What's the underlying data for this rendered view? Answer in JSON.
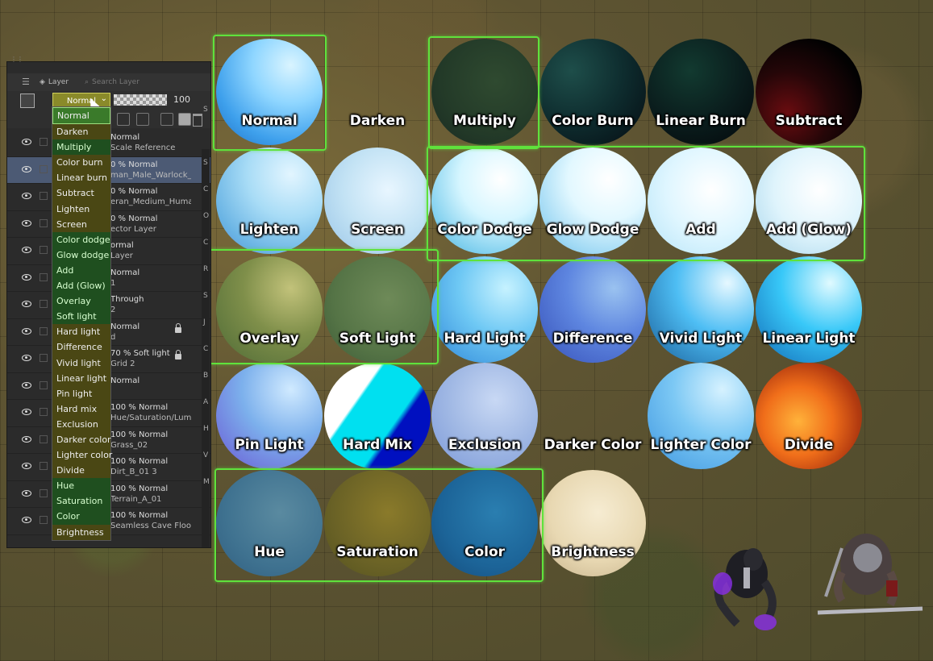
{
  "panel": {
    "tab_layer": "Layer",
    "tab_search": "Search Layer",
    "blend_value": "Normal",
    "opacity": "100",
    "layers": [
      {
        "line1": "Normal",
        "line2": "Scale Reference",
        "sel": false
      },
      {
        "line1": "0 % Normal",
        "line2": "man_Male_Warlock_Mag",
        "sel": true
      },
      {
        "line1": "0 % Normal",
        "line2": "eran_Medium_Humanoid",
        "sel": false
      },
      {
        "line1": "0 % Normal",
        "line2": "ector Layer",
        "sel": false
      },
      {
        "line1": "ormal",
        "line2": "Layer",
        "sel": false
      },
      {
        "line1": "Normal",
        "line2": "1",
        "sel": false
      },
      {
        "line1": "Through",
        "line2": "2",
        "sel": false
      },
      {
        "line1": "Normal",
        "line2": "d",
        "sel": false
      },
      {
        "line1": "70 % Soft light",
        "line2": "Grid 2",
        "sel": false
      },
      {
        "line1": "Normal",
        "line2": "",
        "sel": false
      },
      {
        "line1": "100 % Normal",
        "line2": "Hue/Saturation/Lum",
        "sel": false
      },
      {
        "line1": "100 % Normal",
        "line2": "Grass_02",
        "sel": false
      },
      {
        "line1": "100 % Normal",
        "line2": "Dirt_B_01 3",
        "sel": false
      },
      {
        "line1": "100 % Normal",
        "line2": "Terrain_A_01",
        "sel": false
      },
      {
        "line1": "100 % Normal",
        "line2": "Seamless Cave Floor Tex",
        "sel": false
      }
    ],
    "side_letters": [
      "S",
      "",
      "S",
      "C",
      "O",
      "C",
      "R",
      "S",
      "J",
      "C",
      "B",
      "A",
      "H",
      "V",
      "M"
    ]
  },
  "dropdown": [
    {
      "label": "Normal",
      "style": "sel"
    },
    {
      "label": "Darken",
      "style": "y"
    },
    {
      "label": "Multiply",
      "style": "g"
    },
    {
      "label": "Color burn",
      "style": "y"
    },
    {
      "label": "Linear burn",
      "style": "y"
    },
    {
      "label": "Subtract",
      "style": "y"
    },
    {
      "label": "Lighten",
      "style": "y"
    },
    {
      "label": "Screen",
      "style": "y"
    },
    {
      "label": "Color dodge",
      "style": "g"
    },
    {
      "label": "Glow dodge",
      "style": "g"
    },
    {
      "label": "Add",
      "style": "g"
    },
    {
      "label": "Add (Glow)",
      "style": "g"
    },
    {
      "label": "Overlay",
      "style": "g"
    },
    {
      "label": "Soft light",
      "style": "g"
    },
    {
      "label": "Hard light",
      "style": "y"
    },
    {
      "label": "Difference",
      "style": "y"
    },
    {
      "label": "Vivid light",
      "style": "y"
    },
    {
      "label": "Linear light",
      "style": "y"
    },
    {
      "label": "Pin light",
      "style": "y"
    },
    {
      "label": "Hard mix",
      "style": "y"
    },
    {
      "label": "Exclusion",
      "style": "y"
    },
    {
      "label": "Darker color",
      "style": "y"
    },
    {
      "label": "Lighter color",
      "style": "y"
    },
    {
      "label": "Divide",
      "style": "y"
    },
    {
      "label": "Hue",
      "style": "g"
    },
    {
      "label": "Saturation",
      "style": "g"
    },
    {
      "label": "Color",
      "style": "g"
    },
    {
      "label": "Brightness",
      "style": "y"
    }
  ],
  "circles": [
    {
      "label": "Normal",
      "col": 0,
      "row": 0,
      "fill": "radial-gradient(circle at 70% 25%, #d9f4ff 0%, #8fd6ff 35%, #3ea0ec 70%, #1f6fc4 100%)"
    },
    {
      "label": "Darken",
      "col": 1,
      "row": 0,
      "fill": "transparent"
    },
    {
      "label": "Multiply",
      "col": 2,
      "row": 0,
      "fill": "radial-gradient(circle at 60% 40%, #2f4a30 0%, #233a28 60%, #1a2a22 100%)"
    },
    {
      "label": "Color Burn",
      "col": 3,
      "row": 0,
      "fill": "radial-gradient(circle at 30% 30%, #1e4e4a 0%, #0e2c2e 50%, #050c12 100%)"
    },
    {
      "label": "Linear Burn",
      "col": 4,
      "row": 0,
      "fill": "radial-gradient(circle at 40% 30%, #123a30 0%, #0a1c1c 55%, #03070a 100%)"
    },
    {
      "label": "Subtract",
      "col": 5,
      "row": 0,
      "fill": "radial-gradient(circle at 30% 70%, #6a0c10 0%, #250608 40%, #020202 75%)"
    },
    {
      "label": "Lighten",
      "col": 0,
      "row": 1,
      "fill": "radial-gradient(circle at 70% 25%, #e2f5ff 0%, #a8dcf6 40%, #6ab4e4 75%, #5a8fd8 100%)"
    },
    {
      "label": "Screen",
      "col": 1,
      "row": 1,
      "fill": "radial-gradient(circle at 60% 40%, #e8f6ff 0%, #c2e2f4 50%, #98c4e6 100%)"
    },
    {
      "label": "Color Dodge",
      "col": 2,
      "row": 1,
      "fill": "radial-gradient(circle at 65% 30%, #ffffff 0%, #d6f6ff 40%, #7fcfee 75%, #5a9ec8 100%)"
    },
    {
      "label": "Glow Dodge",
      "col": 3,
      "row": 1,
      "fill": "radial-gradient(circle at 65% 30%, #ffffff 0%, #e2f8ff 40%, #9ed8f4 75%, #6aa8dc 100%)"
    },
    {
      "label": "Add",
      "col": 4,
      "row": 1,
      "fill": "radial-gradient(circle at 60% 40%, #ffffff 0%, #dff6ff 50%, #b6e4f8 100%)"
    },
    {
      "label": "Add (Glow)",
      "col": 5,
      "row": 1,
      "fill": "radial-gradient(circle at 60% 40%, #ffffff 0%, #dff4fc 50%, #a8d6ec 100%)"
    },
    {
      "label": "Overlay",
      "col": 0,
      "row": 2,
      "fill": "radial-gradient(circle at 70% 30%, #c2c27a 0%, #7f8f4a 45%, #4e6a36 100%)"
    },
    {
      "label": "Soft Light",
      "col": 1,
      "row": 2,
      "fill": "radial-gradient(circle at 60% 40%, #6e8a58 0%, #557446 60%, #3e5c38 100%)"
    },
    {
      "label": "Hard Light",
      "col": 2,
      "row": 2,
      "fill": "radial-gradient(circle at 70% 30%, #c6f2ff 0%, #6ec8f4 45%, #2e86d8 100%)"
    },
    {
      "label": "Difference",
      "col": 3,
      "row": 2,
      "fill": "radial-gradient(circle at 70% 30%, #9ac2f0 0%, #5e86e0 45%, #3650b8 100%)"
    },
    {
      "label": "Vivid Light",
      "col": 4,
      "row": 2,
      "fill": "radial-gradient(circle at 75% 25%, #e6f8ff 0%, #4ebef4 45%, #1a5f9a 100%)"
    },
    {
      "label": "Linear Light",
      "col": 5,
      "row": 2,
      "fill": "radial-gradient(circle at 70% 25%, #e0faff 0%, #38c8f8 45%, #126ab6 100%)"
    },
    {
      "label": "Pin Light",
      "col": 0,
      "row": 3,
      "fill": "radial-gradient(circle at 70% 25%, #d0eaff 0%, #7cb0ec 45%, #6a58d4 100%)"
    },
    {
      "label": "Hard Mix",
      "col": 1,
      "row": 3,
      "fill": "linear-gradient(125deg, #ffffff 0%, #ffffff 32%, #00e0f0 34%, #00e0f0 62%, #0010c0 66%, #0010c0 100%)"
    },
    {
      "label": "Exclusion",
      "col": 2,
      "row": 3,
      "fill": "radial-gradient(circle at 60% 35%, #c8d8f4 0%, #a0b8e4 50%, #7c98d8 100%)"
    },
    {
      "label": "Darker Color",
      "col": 3,
      "row": 3,
      "fill": "transparent"
    },
    {
      "label": "Lighter Color",
      "col": 4,
      "row": 3,
      "fill": "radial-gradient(circle at 70% 25%, #d6f2ff 0%, #7cc8f4 45%, #3e96e0 100%)"
    },
    {
      "label": "Divide",
      "col": 5,
      "row": 3,
      "fill": "radial-gradient(circle at 40% 55%, #ffb23a 0%, #f06e1a 40%, #b23a10 70%, #603018 100%)"
    },
    {
      "label": "Hue",
      "col": 0,
      "row": 4,
      "fill": "radial-gradient(circle at 60% 40%, #5a8aa0 0%, #3f7290 60%, #305e80 100%)"
    },
    {
      "label": "Saturation",
      "col": 1,
      "row": 4,
      "fill": "radial-gradient(circle at 60% 40%, #8a7a2a 0%, #6a6226 60%, #54521e 100%)"
    },
    {
      "label": "Color",
      "col": 2,
      "row": 4,
      "fill": "radial-gradient(circle at 60% 40%, #2a7eb0 0%, #1c6498 60%, #154c7c 100%)"
    },
    {
      "label": "Brightness",
      "col": 3,
      "row": 4,
      "fill": "radial-gradient(circle at 55% 40%, #f6ecd2 0%, #e8d8b2 55%, #c4b08a 100%)"
    }
  ],
  "colors": {
    "highlight": "#5fe23c",
    "panel_bg": "#2b2b2b",
    "selected_layer": "#4c5a74"
  }
}
